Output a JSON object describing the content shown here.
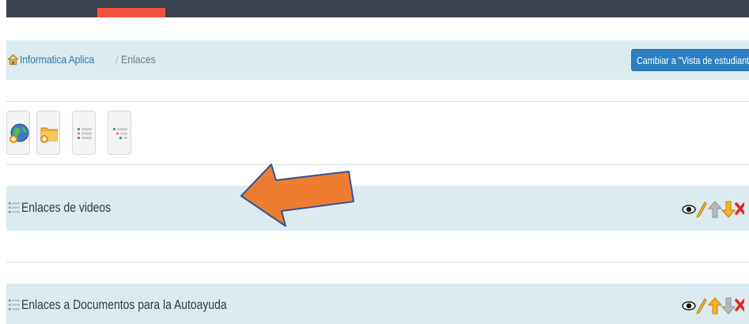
{
  "breadcrumb": {
    "course": "Informatica Aplica",
    "separator": "/",
    "current": "Enlaces"
  },
  "view_switch": {
    "label": "Cambiar a \"Vista de estudiante\""
  },
  "toolbar": {
    "icons": [
      "add-link-icon",
      "add-category-icon",
      "list-view-icon",
      "collapsed-list-icon"
    ]
  },
  "sections": [
    {
      "title": "Enlaces de videos",
      "actions": [
        "visibility-icon",
        "edit-icon",
        "move-up-icon",
        "move-down-icon",
        "delete-icon"
      ]
    },
    {
      "title": "Enlaces a Documentos para la Autoayuda",
      "actions": [
        "visibility-icon",
        "edit-icon",
        "move-up-icon",
        "move-down-icon",
        "delete-icon"
      ]
    }
  ],
  "colors": {
    "topbar": "#3b4450",
    "topbar_accent": "#f0533a",
    "panel": "#dcebf0",
    "primary_button": "#2d7fc4",
    "annotation_arrow": "#ee7d31"
  }
}
